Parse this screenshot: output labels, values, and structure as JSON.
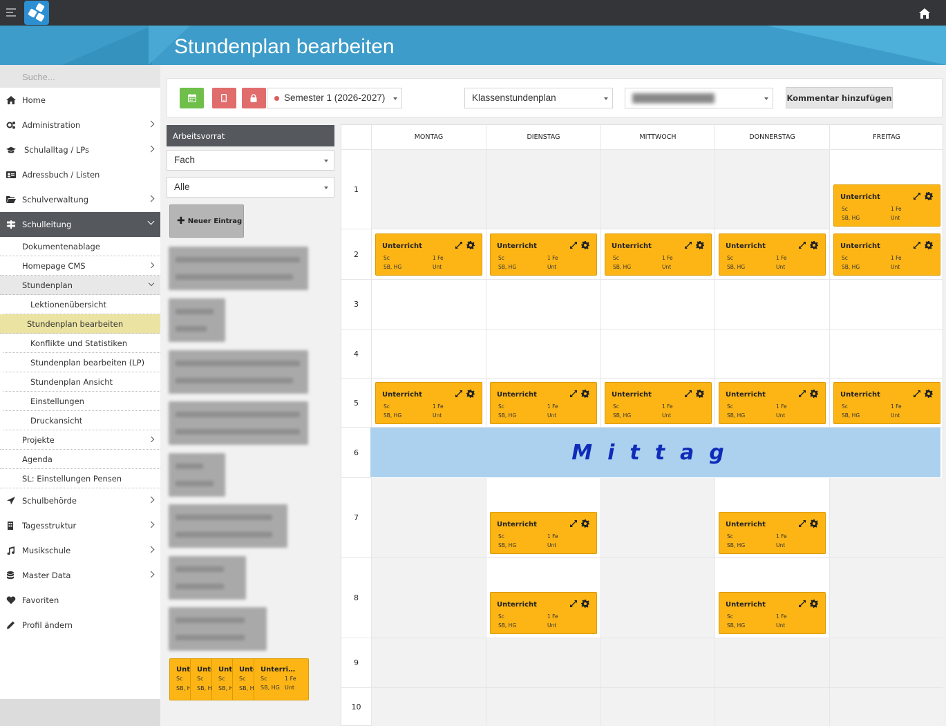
{
  "page": {
    "title": "Stundenplan bearbeiten"
  },
  "sidebar": {
    "search_placeholder": "Suche...",
    "items": [
      {
        "label": "Home"
      },
      {
        "label": "Administration"
      },
      {
        "label": "Schulalltag / LPs"
      },
      {
        "label": "Adressbuch / Listen"
      },
      {
        "label": "Schulverwaltung"
      },
      {
        "label": "Schulleitung"
      }
    ],
    "schulleitung_sub": [
      {
        "label": "Dokumentenablage"
      },
      {
        "label": "Homepage CMS"
      },
      {
        "label": "Stundenplan"
      }
    ],
    "stundenplan_sub": [
      {
        "label": "Lektionenübersicht"
      },
      {
        "label": "Stundenplan bearbeiten"
      },
      {
        "label": "Konflikte und Statistiken"
      },
      {
        "label": "Stundenplan bearbeiten (LP)"
      },
      {
        "label": "Stundenplan Ansicht"
      },
      {
        "label": "Einstellungen"
      },
      {
        "label": "Druckansicht"
      }
    ],
    "schulleitung_sub2": [
      {
        "label": "Projekte"
      },
      {
        "label": "Agenda"
      },
      {
        "label": "SL: Einstellungen Pensen"
      }
    ],
    "items2": [
      {
        "label": "Schulbehörde"
      },
      {
        "label": "Tagesstruktur"
      },
      {
        "label": "Musikschule"
      },
      {
        "label": "Master Data"
      },
      {
        "label": "Favoriten"
      },
      {
        "label": "Profil ändern"
      }
    ]
  },
  "toolbar": {
    "semester": "Semester 1 (2026-2027)",
    "plan_type": "Klassenstundenplan",
    "comment_button": "Kommentar hinzufügen"
  },
  "worklist": {
    "header": "Arbeitsvorrat",
    "filter1": "Fach",
    "filter2": "Alle",
    "new_entry": "Neuer Eintrag",
    "stack_title_short": "Unte",
    "stack_title_full": "Unterri…"
  },
  "grid": {
    "days": [
      "MONTAG",
      "DIENSTAG",
      "MITTWOCH",
      "DONNERSTAG",
      "FREITAG"
    ],
    "periods": [
      "1",
      "2",
      "3",
      "4",
      "5",
      "6",
      "7",
      "8",
      "9",
      "10"
    ],
    "break_label": "Mittag"
  },
  "card": {
    "title": "Unterricht",
    "subject": "Sc",
    "teachers": "SB, HG",
    "room": "1 Fe",
    "type": "Unt"
  },
  "colors": {
    "lesson_card": "#fdb515",
    "break_row": "#acd1ef",
    "banner": "#3d9cc9",
    "active_nav": "#55595e",
    "selected_subnav": "#ebe3a2"
  }
}
